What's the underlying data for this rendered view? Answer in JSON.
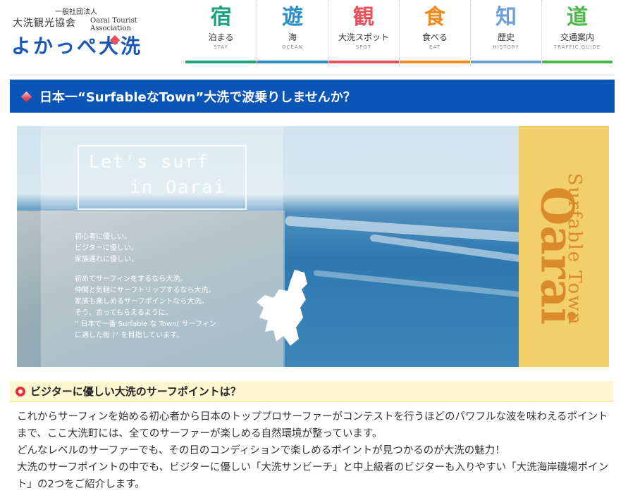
{
  "header": {
    "org_label": "一般社団法人",
    "assoc_name": "大洗観光協会",
    "assoc_name_en": "Oarai Tourist Association",
    "slogan": "よかっぺ大洗",
    "nav": [
      {
        "icon": "宿",
        "label": "泊まる",
        "en": "STAY",
        "color": "#1ba17e",
        "icon_name": "stay-icon"
      },
      {
        "icon": "遊",
        "label": "海",
        "en": "OCEAN",
        "color": "#2a8fc9",
        "icon_name": "ocean-icon"
      },
      {
        "icon": "観",
        "label": "大洗スポット",
        "en": "SPOT",
        "color": "#e8505b",
        "icon_name": "spot-icon"
      },
      {
        "icon": "食",
        "label": "食べる",
        "en": "EAT",
        "color": "#f08a1c",
        "icon_name": "eat-icon"
      },
      {
        "icon": "知",
        "label": "歴史",
        "en": "HISTORY",
        "color": "#6d9fd8",
        "icon_name": "history-icon"
      },
      {
        "icon": "道",
        "label": "交通案内",
        "en": "TRAFFIC GUIDE",
        "color": "#4bb848",
        "icon_name": "traffic-icon"
      }
    ]
  },
  "title_bar": {
    "heading": "日本一“SurfableなTown”大洗で波乗りしませんか？"
  },
  "hero": {
    "lets_line1": "Let's surf",
    "lets_line2": "in Oarai",
    "intro_group1": [
      "初心者に優しい。",
      "ビジターに優しい。",
      "家族連れに優しい。"
    ],
    "intro_group2": [
      "初めてサーフィンをするなら大洗。",
      "仲間と気軽にサーフトリップするなら大洗。",
      "家族も楽しめるサーフポイントなら大洗。",
      "そう、言ってもらえるように。",
      "” 日本で一番 Surfable な Town( サーフィン",
      "に適した街 )” を目指しています。"
    ],
    "vertical_big": "Oarai",
    "vertical_small": "Surfable Town"
  },
  "section": {
    "heading": "ビジターに優しい大洗のサーフポイントは？",
    "paragraphs": [
      "これからサーフィンを始める初心者から日本のトッププロサーファーがコンテストを行うほどのパワフルな波を味わえるポイントまで、ここ大洗町には、全てのサーファーが楽しめる自然環境が整っています。",
      "どんなレベルのサーファーでも、その日のコンディションで楽しめるポイントが見つかるのが大洗の魅力！",
      "大洗のサーフポイントの中でも、ビジターに優しい「大洗サンビーチ」と中上級者のビジターも入りやすい「大洗海岸磯場ポイント」の2つをご紹介します。"
    ]
  },
  "colors": {
    "title_bar_bg": "#0b55b6",
    "section_bg": "#fff7cf",
    "accent_red": "#e4313a",
    "hero_yellow": "#f3cf69",
    "hero_orange_text": "#d98a2b"
  }
}
